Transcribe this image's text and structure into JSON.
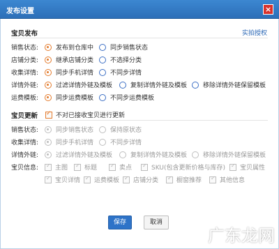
{
  "dialog": {
    "title": "发布设置",
    "close_icon": "close-icon"
  },
  "publish": {
    "title": "宝贝发布",
    "auth_link": "实拍授权",
    "rows": [
      {
        "label": "销售状态:",
        "options": [
          "发布到仓库中",
          "同步销售状态"
        ],
        "selected": 0
      },
      {
        "label": "店铺分类:",
        "options": [
          "继承店铺分类",
          "不选择分类"
        ],
        "selected": 0
      },
      {
        "label": "收集详情:",
        "options": [
          "同步手机详情",
          "不同步详情"
        ],
        "selected": 0
      },
      {
        "label": "详情外链:",
        "options": [
          "过滤详情外链及模板",
          "复制详情外链及模板",
          "移除详情外链保留模板"
        ],
        "selected": 0
      },
      {
        "label": "运费模板:",
        "options": [
          "同步运费模板",
          "不同步运费模板"
        ],
        "selected": 0
      }
    ]
  },
  "update": {
    "title": "宝贝更新",
    "no_update_checkbox": "不对已接收宝贝进行更新",
    "rows": [
      {
        "label": "销售状态:",
        "options": [
          "同步销售状态",
          "保持原状态"
        ]
      },
      {
        "label": "收集详情:",
        "options": [
          "同步手机详情",
          "不同步详情"
        ]
      },
      {
        "label": "详情外链:",
        "options": [
          "过滤详情外链及模板",
          "复制详情外链及模板",
          "移除详情外链保留模板"
        ]
      }
    ],
    "info_label": "宝贝信息:",
    "info_items_row1": [
      "主图",
      "标题",
      "卖点",
      "SKU(包含更新价格与库存)",
      "宝贝属性"
    ],
    "info_items_row2": [
      "宝贝详情",
      "运费模板",
      "店铺分类",
      "橱窗推荐",
      "其他信息"
    ]
  },
  "buttons": {
    "save": "保存",
    "cancel": "取消"
  },
  "watermark": "广东龙网",
  "colors": {
    "titlebar": "#2f74bf",
    "accent": "#e37a2b",
    "close": "#d9322b"
  }
}
